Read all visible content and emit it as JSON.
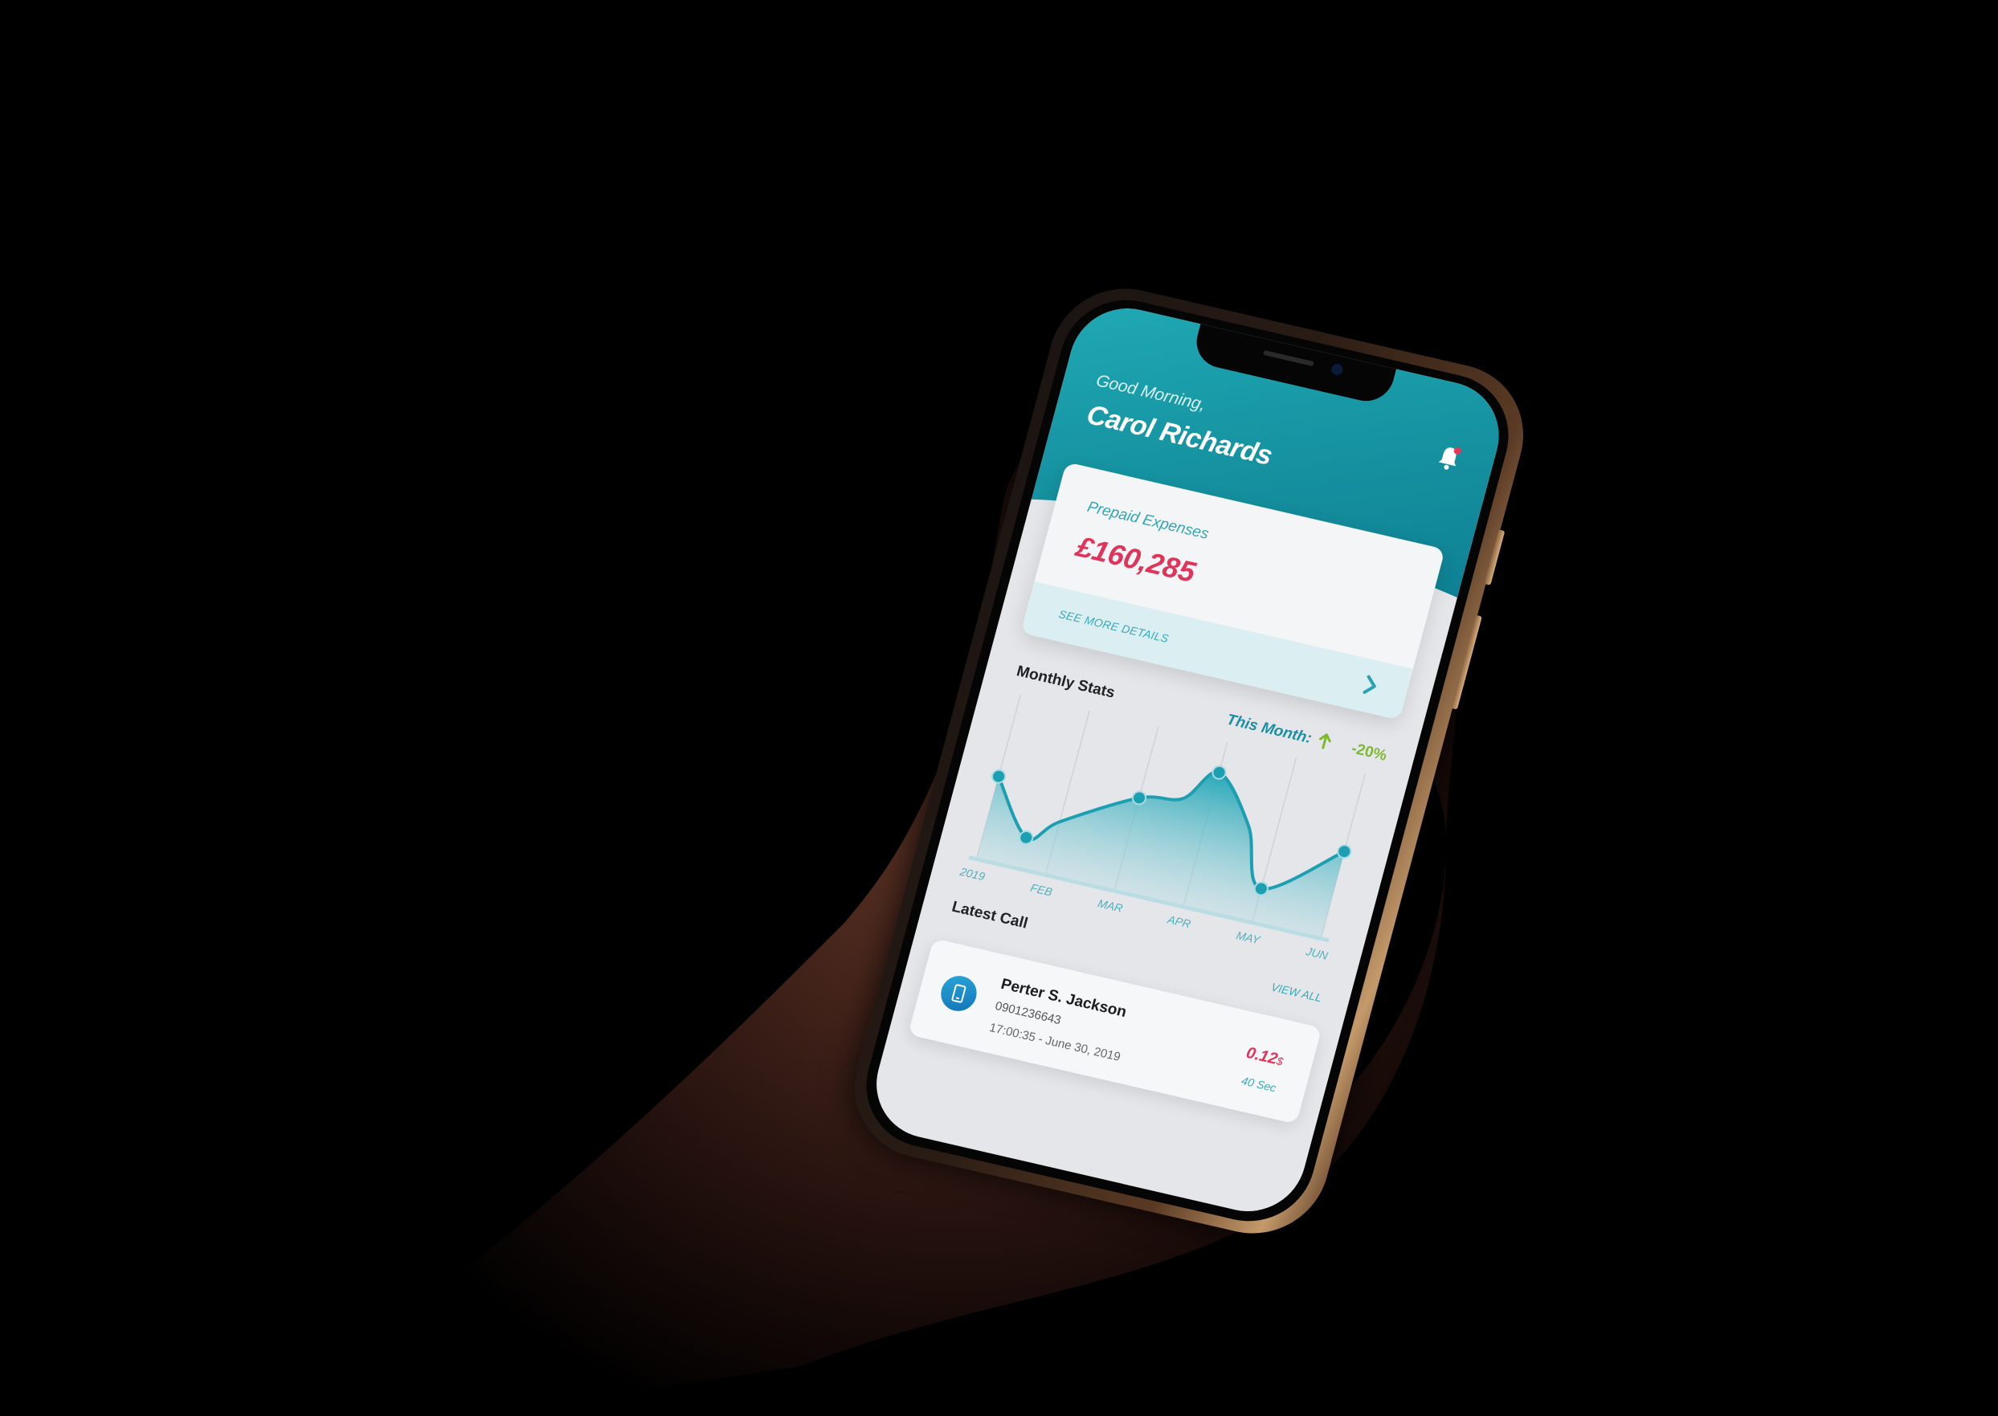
{
  "colors": {
    "background": "#000000",
    "header_teal": "#15909f",
    "accent_teal": "#2fa6b3",
    "amount_red": "#e0355a",
    "delta_green": "#7fb832"
  },
  "header": {
    "greeting": "Good Morning,",
    "user_name": "Carol Richards",
    "notification_icon": "bell-icon"
  },
  "balance_card": {
    "label": "Prepaid Expenses",
    "amount": "£160,285",
    "details_link": "SEE MORE DETAILS",
    "chevron_icon": "chevron-right-icon"
  },
  "stats": {
    "title": "Monthly Stats",
    "this_month_label": "This Month:",
    "trend_icon": "arrow-up-icon",
    "delta": "-20%"
  },
  "chart_data": {
    "type": "area",
    "categories": [
      "2019",
      "FEB",
      "MAR",
      "APR",
      "MAY",
      "JUN"
    ],
    "x": [
      0,
      0.6,
      1,
      2,
      2.6,
      3,
      3.6,
      4,
      5
    ],
    "values": [
      55,
      20,
      35,
      62,
      68,
      90,
      60,
      22,
      58
    ],
    "ylim": [
      0,
      100
    ],
    "grid": "vertical",
    "marked_points": [
      0,
      1,
      3,
      5,
      7,
      8
    ]
  },
  "latest_call": {
    "title": "Latest Call",
    "view_all": "VIEW ALL",
    "item": {
      "icon": "phone-icon",
      "name": "Perter S. Jackson",
      "number": "0901236643",
      "time": "17:00:35 - June 30, 2019",
      "cost": "0.12",
      "cost_unit": "$",
      "duration": "40 Sec"
    }
  }
}
